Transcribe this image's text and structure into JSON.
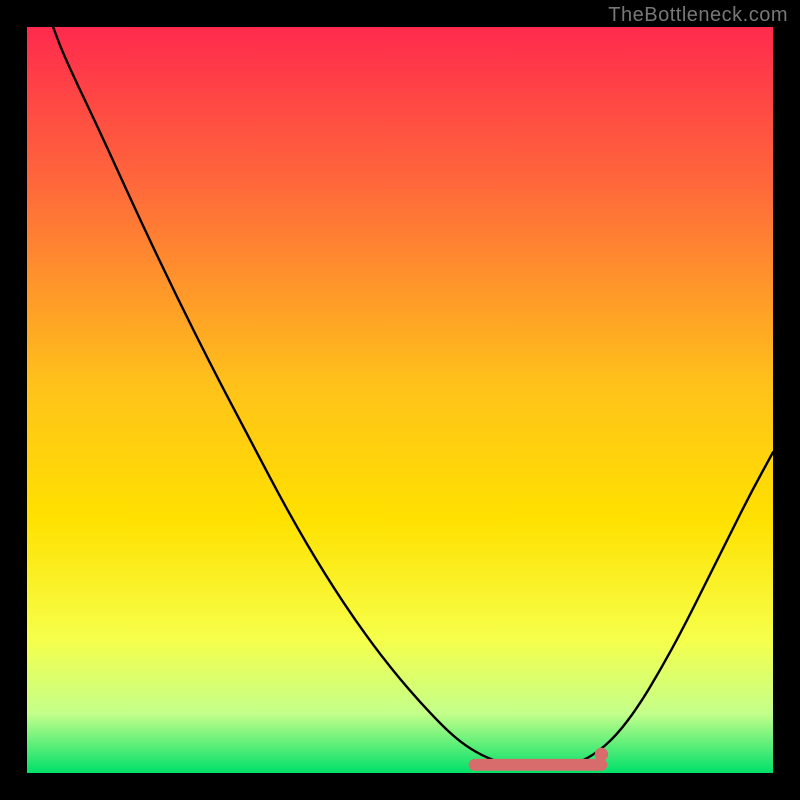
{
  "watermark": "TheBottleneck.com",
  "colors": {
    "black": "#000000",
    "curve": "#000000",
    "marker": "#d86b6b",
    "dot": "#d86b6b",
    "gradient_top": "#ff2a4d",
    "gradient_mid1": "#ff6b3a",
    "gradient_mid2": "#ffc21a",
    "gradient_mid3": "#ffe100",
    "gradient_mid4": "#f6ff4a",
    "gradient_mid5": "#c4ff8a",
    "gradient_bottom": "#00e06a"
  },
  "chart_data": {
    "type": "line",
    "title": "",
    "xlabel": "",
    "ylabel": "",
    "xlim": [
      0,
      100
    ],
    "ylim": [
      0,
      100
    ],
    "grid": false,
    "curve": [
      {
        "x": 3.5,
        "y": 100.0
      },
      {
        "x": 5.0,
        "y": 96.0
      },
      {
        "x": 10.0,
        "y": 85.5
      },
      {
        "x": 15.0,
        "y": 74.5
      },
      {
        "x": 20.0,
        "y": 64.0
      },
      {
        "x": 25.0,
        "y": 54.0
      },
      {
        "x": 30.0,
        "y": 44.5
      },
      {
        "x": 35.0,
        "y": 35.0
      },
      {
        "x": 40.0,
        "y": 26.5
      },
      {
        "x": 45.0,
        "y": 19.0
      },
      {
        "x": 50.0,
        "y": 12.5
      },
      {
        "x": 55.0,
        "y": 7.0
      },
      {
        "x": 58.0,
        "y": 4.2
      },
      {
        "x": 61.0,
        "y": 2.3
      },
      {
        "x": 64.0,
        "y": 1.2
      },
      {
        "x": 67.0,
        "y": 0.7
      },
      {
        "x": 70.0,
        "y": 0.6
      },
      {
        "x": 73.0,
        "y": 1.0
      },
      {
        "x": 76.0,
        "y": 2.4
      },
      {
        "x": 79.0,
        "y": 5.0
      },
      {
        "x": 82.0,
        "y": 9.0
      },
      {
        "x": 85.0,
        "y": 14.0
      },
      {
        "x": 88.0,
        "y": 19.5
      },
      {
        "x": 91.0,
        "y": 25.5
      },
      {
        "x": 94.0,
        "y": 31.5
      },
      {
        "x": 97.0,
        "y": 37.5
      },
      {
        "x": 100.0,
        "y": 43.0
      }
    ],
    "optimal_band": {
      "x_start": 60.0,
      "x_end": 77.0,
      "y": 1.1,
      "thickness": 1.6
    },
    "end_dot": {
      "x": 77.0,
      "y": 2.5,
      "r": 0.9
    }
  }
}
